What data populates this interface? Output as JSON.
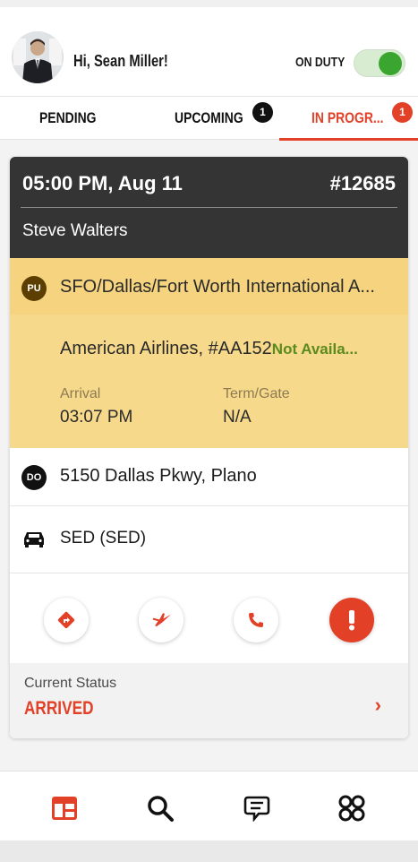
{
  "header": {
    "greeting": "Hi, Sean Miller!",
    "duty_label": "ON DUTY",
    "duty_on": true,
    "accent": "#e24128",
    "toggle_color": "#3aa52f"
  },
  "tabs": [
    {
      "label": "PENDING",
      "badge": null
    },
    {
      "label": "UPCOMING",
      "badge": "1"
    },
    {
      "label": "IN PROGR...",
      "badge": "1",
      "active": true
    }
  ],
  "trip": {
    "time": "05:00 PM, Aug 11",
    "id": "#12685",
    "passenger": "Steve Walters",
    "pickup": {
      "badge": "PU",
      "address": "SFO/Dallas/Fort Worth International A...",
      "flight": "American Airlines, #AA152",
      "flight_status": "Not Availa...",
      "arrival_label": "Arrival",
      "arrival_value": "03:07 PM",
      "gate_label": "Term/Gate",
      "gate_value": "N/A"
    },
    "dropoff": {
      "badge": "DO",
      "address": "5150 Dallas Pkwy, Plano"
    },
    "vehicle": {
      "icon": "car-icon",
      "text": "SED (SED)"
    },
    "actions": [
      {
        "icon": "directions-icon"
      },
      {
        "icon": "flight-icon"
      },
      {
        "icon": "phone-icon"
      },
      {
        "icon": "alert-icon"
      }
    ],
    "status": {
      "label": "Current Status",
      "value": "ARRIVED"
    }
  },
  "bottom_nav": [
    {
      "icon": "dashboard-icon",
      "active": true
    },
    {
      "icon": "search-icon"
    },
    {
      "icon": "chat-icon"
    },
    {
      "icon": "apps-icon"
    }
  ]
}
